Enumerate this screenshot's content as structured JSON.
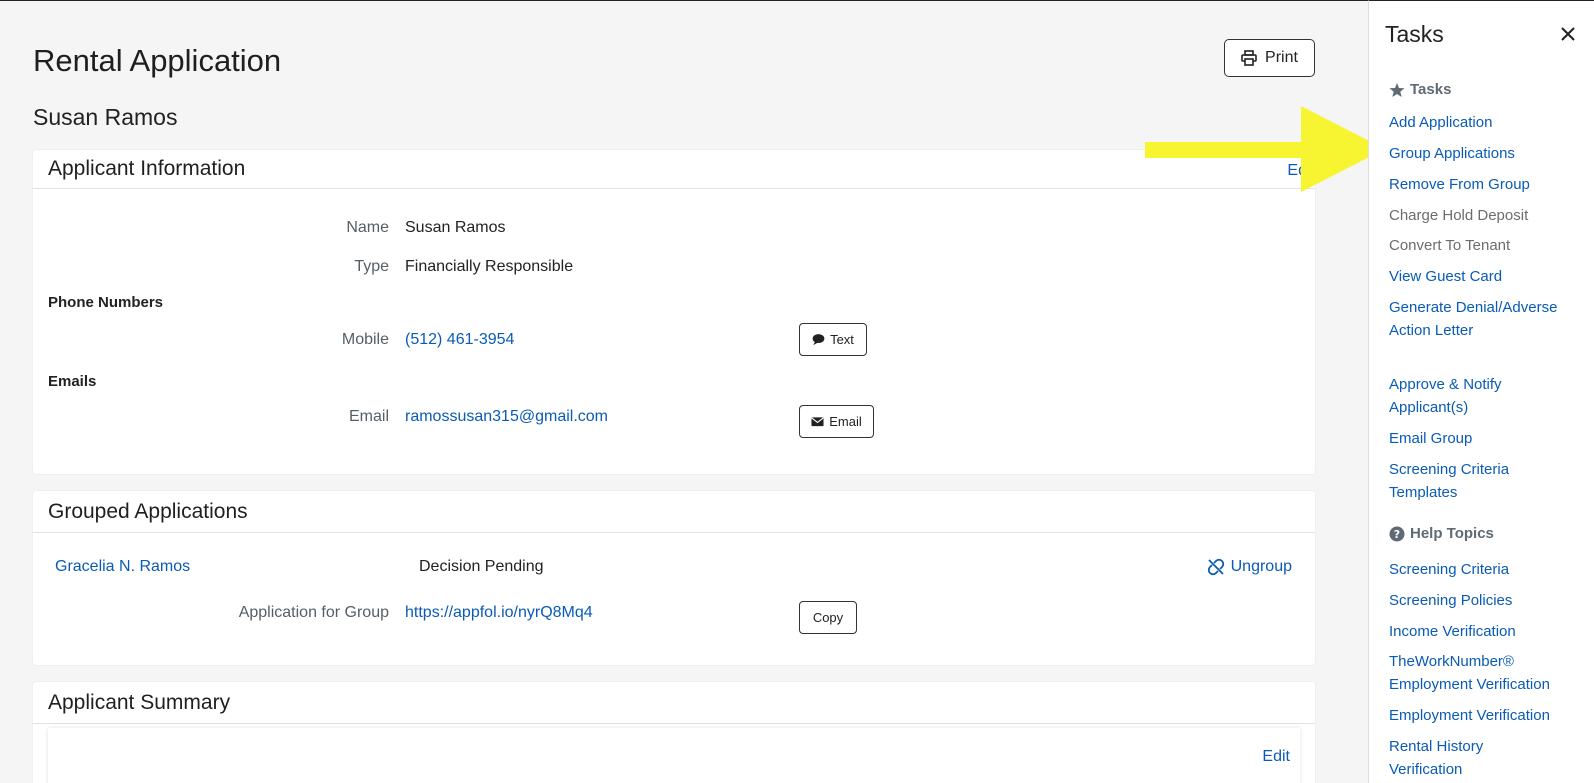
{
  "page": {
    "title": "Rental Application",
    "print_label": "Print",
    "applicant_name": "Susan Ramos"
  },
  "applicant_info": {
    "title": "Applicant Information",
    "edit_label": "Ed",
    "name_label": "Name",
    "name_value": "Susan Ramos",
    "type_label": "Type",
    "type_value": "Financially Responsible",
    "phone_section": "Phone Numbers",
    "mobile_label": "Mobile",
    "mobile_value": "(512) 461-3954",
    "text_button": "Text",
    "emails_section": "Emails",
    "email_label": "Email",
    "email_value": "ramossusan315@gmail.com",
    "email_button": "Email"
  },
  "grouped": {
    "title": "Grouped Applications",
    "member_name": "Gracelia N. Ramos",
    "member_status": "Decision Pending",
    "ungroup_label": "Ungroup",
    "group_link_label": "Application for Group",
    "group_link_value": "https://appfol.io/nyrQ8Mq4",
    "copy_button": "Copy"
  },
  "summary": {
    "title": "Applicant Summary",
    "edit_label": "Edit"
  },
  "sidebar": {
    "title": "Tasks",
    "tasks_heading": "Tasks",
    "tasks": [
      {
        "label": "Add Application",
        "enabled": true
      },
      {
        "label": "Group Applications",
        "enabled": true
      },
      {
        "label": "Remove From Group",
        "enabled": true
      },
      {
        "label": "Charge Hold Deposit",
        "enabled": false
      },
      {
        "label": "Convert To Tenant",
        "enabled": false
      },
      {
        "label": "View Guest Card",
        "enabled": true
      },
      {
        "label": "Generate Denial/Adverse Action Letter",
        "enabled": true
      },
      {
        "label": "Approve & Notify Applicant(s)",
        "enabled": true
      },
      {
        "label": "Email Group",
        "enabled": true
      },
      {
        "label": "Screening Criteria Templates",
        "enabled": true
      }
    ],
    "help_heading": "Help Topics",
    "help": [
      {
        "label": "Screening Criteria"
      },
      {
        "label": "Screening Policies"
      },
      {
        "label": "Income Verification"
      },
      {
        "label": "TheWorkNumber® Employment Verification"
      },
      {
        "label": "Employment Verification"
      },
      {
        "label": "Rental History Verification"
      }
    ]
  },
  "colors": {
    "link": "#0a5bb5",
    "arrow": "#f7f531",
    "background": "#f5f5f5"
  }
}
